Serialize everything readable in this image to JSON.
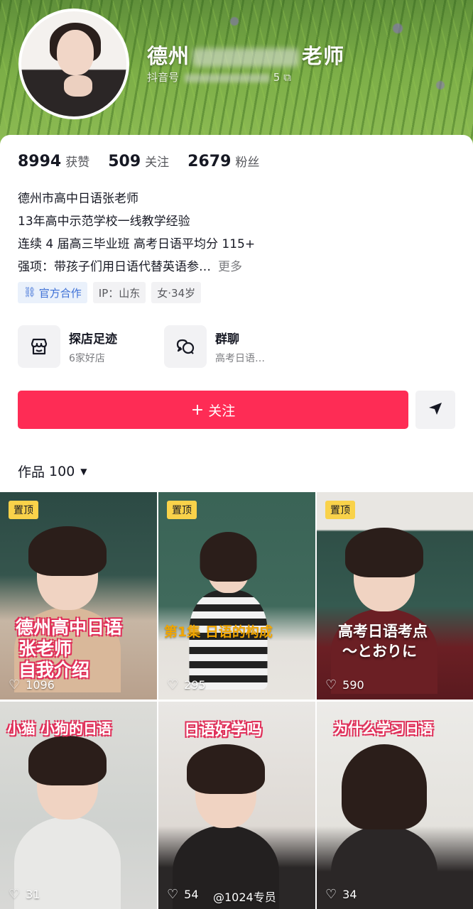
{
  "profile": {
    "display_name_prefix": "德州",
    "display_name_suffix": "老师",
    "account_id_label": "抖音号",
    "account_id_tail": "5 ⧉"
  },
  "stats": [
    {
      "value": "8994",
      "label": "获赞"
    },
    {
      "value": "509",
      "label": "关注"
    },
    {
      "value": "2679",
      "label": "粉丝"
    }
  ],
  "bio": {
    "lines": [
      "德州市高中日语张老师",
      "13年高中示范学校一线教学经验",
      "连续 4 届高三毕业班 高考日语平均分 115+",
      "强项：带孩子们用日语代替英语参…"
    ],
    "more": "更多"
  },
  "tags": {
    "official": "官方合作",
    "ip": "IP：山东",
    "gender_age": "女·34岁"
  },
  "features": [
    {
      "title": "探店足迹",
      "sub": "6家好店",
      "icon": "store-icon"
    },
    {
      "title": "群聊",
      "sub": "高考日语…",
      "icon": "chat-icon"
    }
  ],
  "actions": {
    "follow_label": "关注",
    "share_icon": "send-icon"
  },
  "works": {
    "label": "作品",
    "count": "100"
  },
  "videos": [
    {
      "pinned": "置顶",
      "title_lines": [
        "德州高中日语",
        "张老师",
        "自我介绍"
      ],
      "likes": "1096"
    },
    {
      "pinned": "置顶",
      "title_lines": [
        "第1集 日语的构成"
      ],
      "likes": "295"
    },
    {
      "pinned": "置顶",
      "title_lines": [
        "高考日语考点",
        "～とおりに"
      ],
      "likes": "590"
    },
    {
      "pinned": "",
      "title_lines": [
        "小猫 小狗的日语"
      ],
      "likes": "31"
    },
    {
      "pinned": "",
      "title_lines": [
        "日语好学吗"
      ],
      "likes": "54"
    },
    {
      "pinned": "",
      "title_lines": [
        "为什么学习日语"
      ],
      "likes": "34"
    }
  ],
  "watermark": "@1024专员",
  "colors": {
    "accent": "#fe2c55",
    "pin": "#f9d24a",
    "official": "#3c6fd6"
  }
}
